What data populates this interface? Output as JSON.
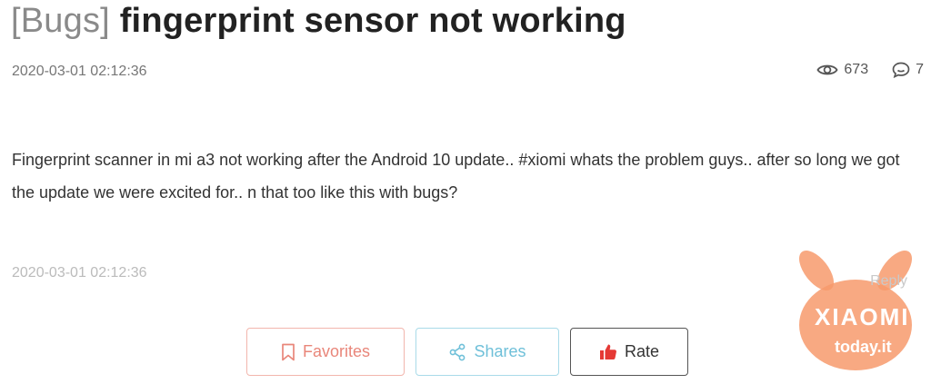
{
  "post": {
    "tag": "[Bugs]",
    "title": "fingerprint sensor not working",
    "date": "2020-03-01 02:12:36",
    "views": "673",
    "comments": "7",
    "body": "Fingerprint scanner in mi a3 not working after the Android 10 update.. #xiomi  whats the problem guys.. after so long we got the update we were excited for.. n that too like this with bugs?"
  },
  "reply": {
    "date": "2020-03-01 02:12:36",
    "label": "Reply"
  },
  "actions": {
    "favorites": "Favorites",
    "shares": "Shares",
    "rate": "Rate"
  },
  "watermark": {
    "brand": "XIAOMI",
    "site": "today.it"
  },
  "colors": {
    "favorites": "#e9867a",
    "shares": "#6fc0d9",
    "rate_icon": "#e53935",
    "watermark": "#f79a6c"
  },
  "icons": {
    "views": "eye-icon",
    "comments": "comment-icon",
    "favorites": "bookmark-icon",
    "shares": "share-icon",
    "rate": "thumbs-up-icon"
  }
}
